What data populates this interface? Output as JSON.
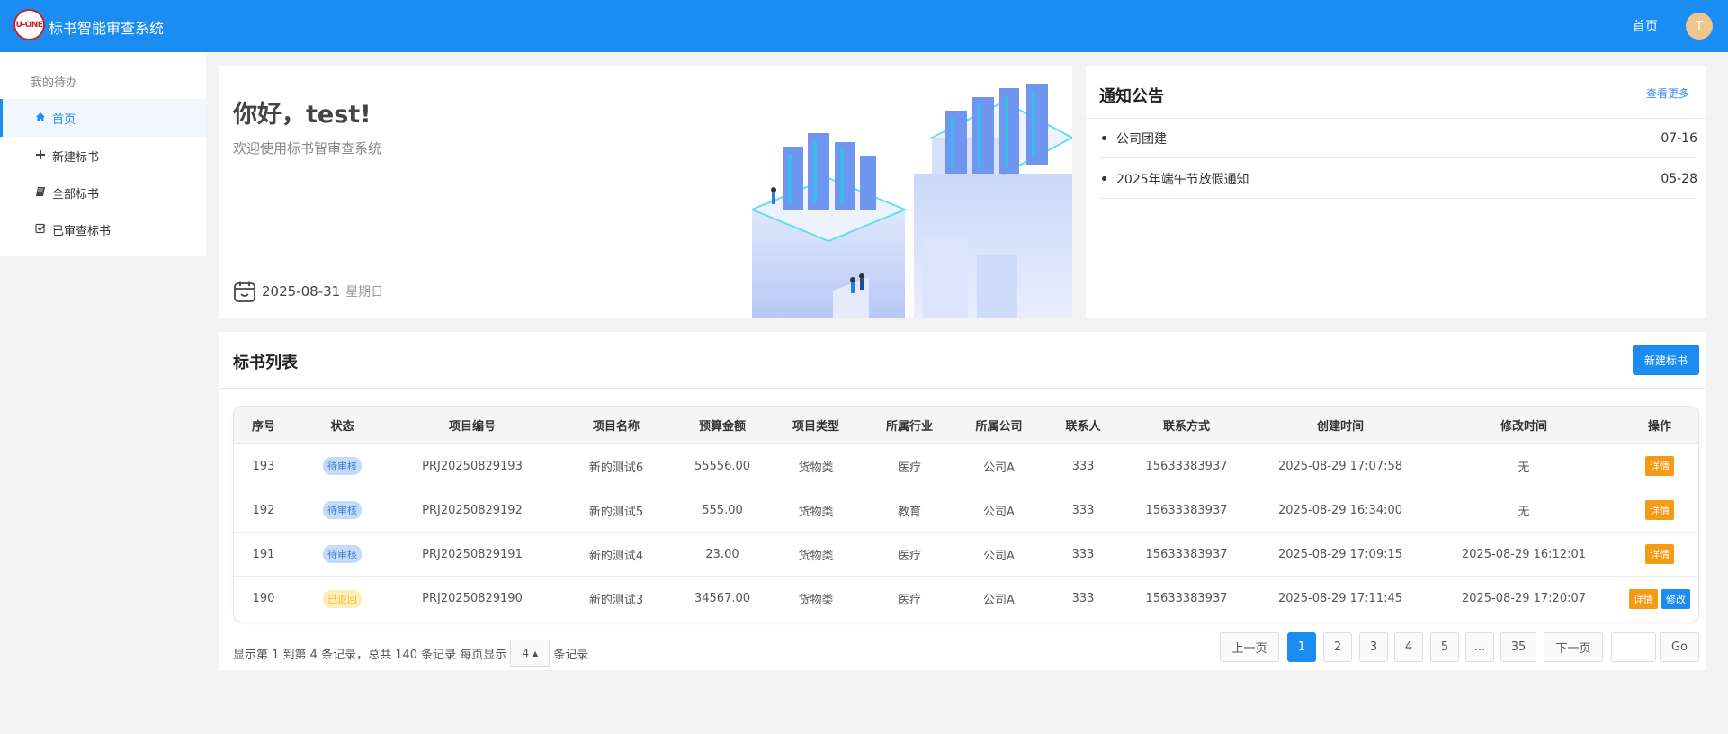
{
  "app": {
    "logo_text": "U-ONE",
    "title": "标书智能审查系统",
    "nav_home": "首页",
    "avatar_initial": "T"
  },
  "sidebar": {
    "header": "我的待办",
    "items": [
      {
        "label": "首页",
        "icon": "home-icon",
        "active": true
      },
      {
        "label": "新建标书",
        "icon": "plus-icon"
      },
      {
        "label": "全部标书",
        "icon": "book-icon"
      },
      {
        "label": "已审查标书",
        "icon": "check-square-icon"
      }
    ]
  },
  "welcome": {
    "greeting": "你好，test!",
    "subtitle": "欢迎使用标书智审查系统",
    "date": "2025-08-31",
    "weekday": "星期日"
  },
  "notice": {
    "title": "通知公告",
    "more": "查看更多",
    "items": [
      {
        "title": "公司团建",
        "date": "07-16"
      },
      {
        "title": "2025年端午节放假通知",
        "date": "05-28"
      }
    ]
  },
  "list": {
    "title": "标书列表",
    "new_button": "新建标书",
    "columns": [
      "序号",
      "状态",
      "项目编号",
      "项目名称",
      "预算金额",
      "项目类型",
      "所属行业",
      "所属公司",
      "联系人",
      "联系方式",
      "创建时间",
      "修改时间",
      "操作"
    ],
    "rows": [
      {
        "id": "193",
        "status": "待审核",
        "status_type": "pending",
        "code": "PRJ20250829193",
        "name": "新的测试6",
        "budget": "55556.00",
        "type": "货物类",
        "industry": "医疗",
        "company": "公司A",
        "contact": "333",
        "phone": "15633383937",
        "created": "2025-08-29 17:07:58",
        "modified": "无",
        "actions": [
          "详情"
        ]
      },
      {
        "id": "192",
        "status": "待审核",
        "status_type": "pending",
        "code": "PRJ20250829192",
        "name": "新的测试5",
        "budget": "555.00",
        "type": "货物类",
        "industry": "教育",
        "company": "公司A",
        "contact": "333",
        "phone": "15633383937",
        "created": "2025-08-29 16:34:00",
        "modified": "无",
        "actions": [
          "详情"
        ]
      },
      {
        "id": "191",
        "status": "待审核",
        "status_type": "pending",
        "code": "PRJ20250829191",
        "name": "新的测试4",
        "budget": "23.00",
        "type": "货物类",
        "industry": "医疗",
        "company": "公司A",
        "contact": "333",
        "phone": "15633383937",
        "created": "2025-08-29 17:09:15",
        "modified": "2025-08-29 16:12:01",
        "actions": [
          "详情"
        ]
      },
      {
        "id": "190",
        "status": "已退回",
        "status_type": "returned",
        "code": "PRJ20250829190",
        "name": "新的测试3",
        "budget": "34567.00",
        "type": "货物类",
        "industry": "医疗",
        "company": "公司A",
        "contact": "333",
        "phone": "15633383937",
        "created": "2025-08-29 17:11:45",
        "modified": "2025-08-29 17:20:07",
        "actions": [
          "详情",
          "修改"
        ]
      }
    ]
  },
  "pagination": {
    "info_prefix": "显示第 1 到第 4 条记录，总共 140 条记录 每页显示",
    "page_size": "4",
    "info_suffix": "条记录",
    "prev": "上一页",
    "next": "下一页",
    "pages": [
      "1",
      "2",
      "3",
      "4",
      "5",
      "...",
      "35"
    ],
    "current": "1",
    "go": "Go"
  },
  "colors": {
    "primary": "#1b8cf2",
    "detail_button": "#f39b15",
    "pending_badge": "#c5dcf8",
    "returned_badge": "#fdedb7"
  }
}
